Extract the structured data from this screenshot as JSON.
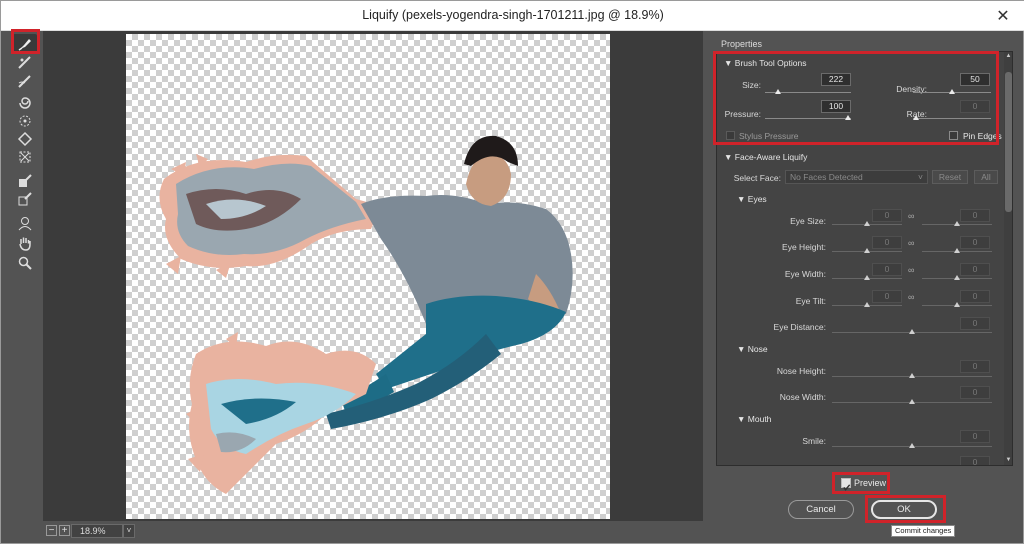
{
  "window": {
    "title": "Liquify (pexels-yogendra-singh-1701211.jpg @ 18.9%)",
    "close_glyph": "✕"
  },
  "tools": [
    "forward-warp-icon",
    "reconstruct-icon",
    "smooth-icon",
    "twirl-icon",
    "pucker-icon",
    "bloat-icon",
    "push-left-icon",
    "freeze-mask-icon",
    "thaw-mask-icon",
    "face-tool-icon",
    "hand-icon",
    "zoom-icon"
  ],
  "status": {
    "zoom": "18.9%",
    "zoom_out": "−",
    "zoom_in": "+",
    "dropdown": "˅"
  },
  "panel": {
    "title": "Properties",
    "brush": {
      "header": "Brush Tool Options",
      "size_label": "Size:",
      "size": "222",
      "size_level": 0.12,
      "density_label": "Density:",
      "density": "50",
      "density_level": 0.5,
      "pressure_label": "Pressure:",
      "pressure": "100",
      "pressure_level": 1.0,
      "rate_label": "Rate:",
      "rate": "0",
      "rate_level": 0.0,
      "stylus_label": "Stylus Pressure",
      "pin_label": "Pin Edges"
    },
    "face": {
      "header": "Face-Aware Liquify",
      "select_label": "Select Face:",
      "select_value": "No Faces Detected",
      "reset": "Reset",
      "all": "All",
      "eyes_header": "Eyes",
      "eye_size": "Eye Size:",
      "eye_height": "Eye Height:",
      "eye_width": "Eye Width:",
      "eye_tilt": "Eye Tilt:",
      "eye_distance": "Eye Distance:",
      "nose_header": "Nose",
      "nose_height": "Nose Height:",
      "nose_width": "Nose Width:",
      "mouth_header": "Mouth",
      "smile": "Smile:",
      "zero": "0"
    },
    "preview_label": "Preview",
    "cancel": "Cancel",
    "ok": "OK",
    "tooltip": "Commit changes"
  },
  "colors": {
    "highlight": "#d0232a",
    "bg": "#535353",
    "panel": "#444444"
  }
}
